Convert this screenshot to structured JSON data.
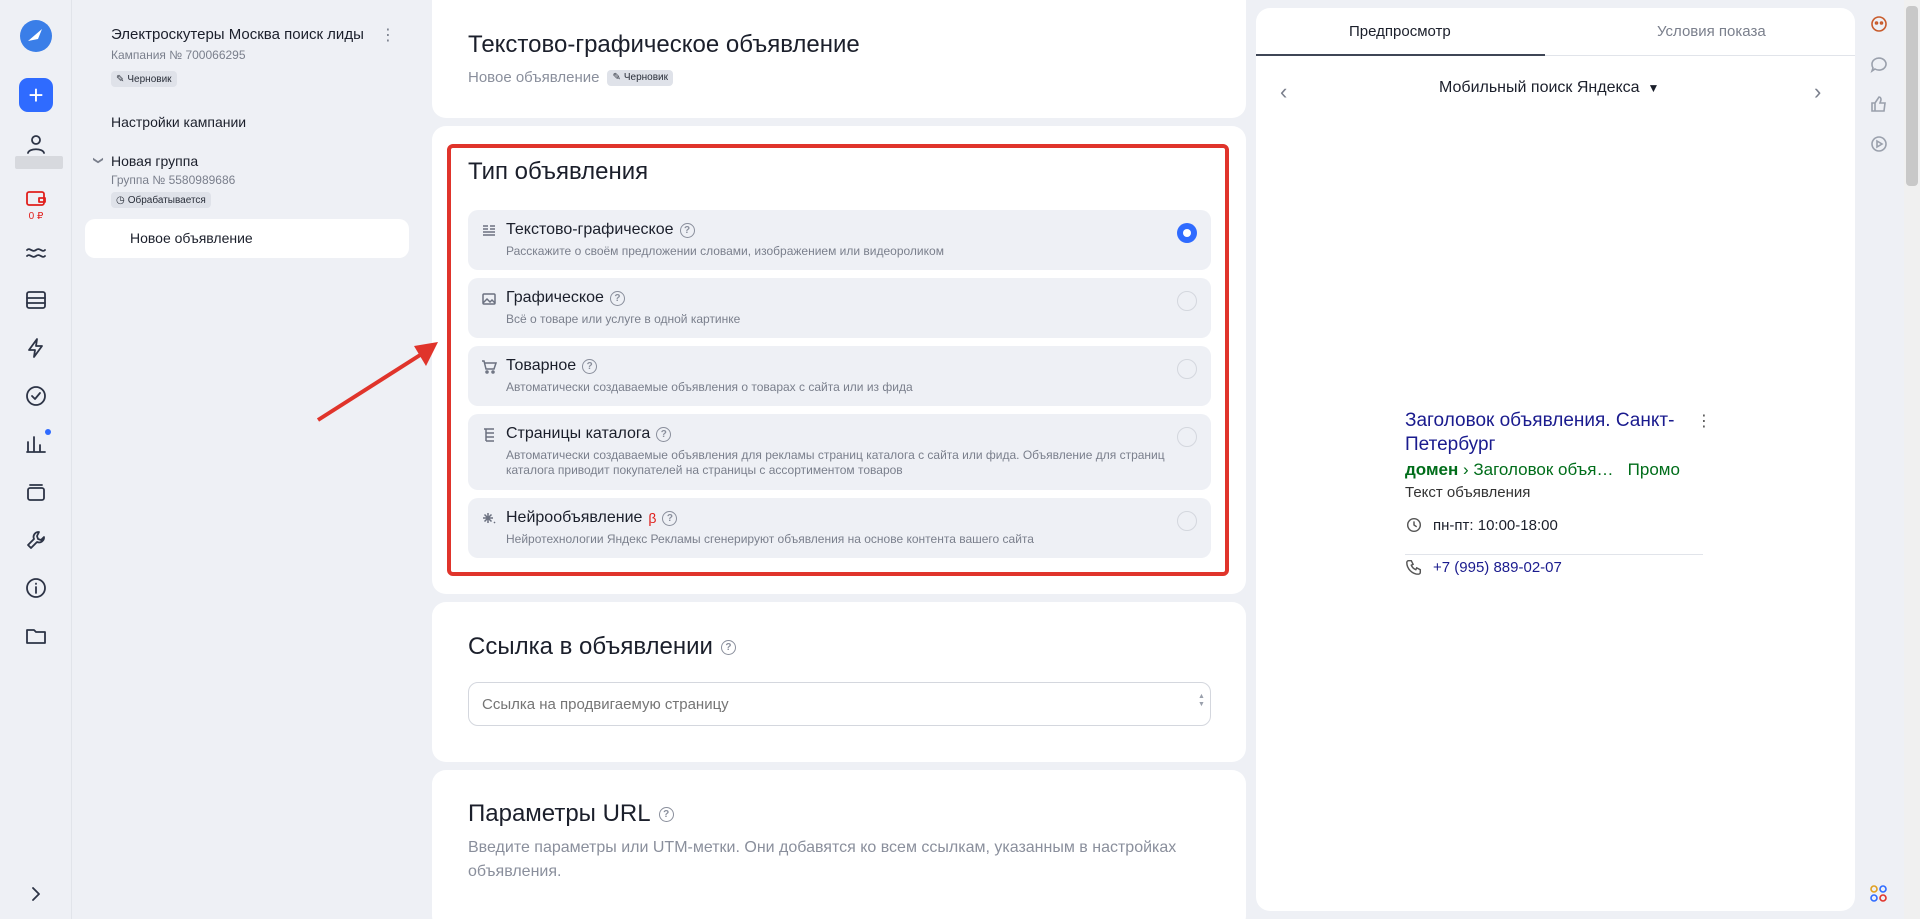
{
  "rail": {
    "wallet_amount": "0 ₽"
  },
  "sidebar": {
    "campaign_title": "Электроскутеры Москва поиск лиды",
    "campaign_number": "Кампания № 700066295",
    "campaign_status": "Черновик",
    "campaign_settings": "Настройки кампании",
    "group_title": "Новая группа",
    "group_number": "Группа № 5580989686",
    "group_status": "Обрабатывается",
    "ad_item": "Новое объявление"
  },
  "header": {
    "title": "Текстово-графическое объявление",
    "subtitle": "Новое объявление",
    "status": "Черновик"
  },
  "ad_type": {
    "title": "Тип объявления",
    "options": [
      {
        "label": "Текстово-графическое",
        "desc": "Расскажите о своём предложении словами, изображением или видеороликом",
        "selected": true,
        "icon": "text-lines-icon"
      },
      {
        "label": "Графическое",
        "desc": "Всё о товаре или услуге в одной картинке",
        "selected": false,
        "icon": "image-icon"
      },
      {
        "label": "Товарное",
        "desc": "Автоматически создаваемые объявления о товарах с сайта или из фида",
        "selected": false,
        "icon": "cart-icon"
      },
      {
        "label": "Страницы каталога",
        "desc": "Автоматически создаваемые объявления для рекламы страниц каталога с сайта или фида. Объявление для страниц каталога приводит покупателей на страницы с ассортиментом товаров",
        "selected": false,
        "icon": "catalog-tree-icon"
      },
      {
        "label": "Нейрообъявление",
        "beta": "β",
        "desc": "Нейротехнологии Яндекс Рекламы сгенерируют объявления на основе контента вашего сайта",
        "selected": false,
        "icon": "sparkle-icon"
      }
    ]
  },
  "link_section": {
    "title": "Ссылка в объявлении",
    "placeholder": "Ссылка на продвигаемую страницу"
  },
  "url_params": {
    "title": "Параметры URL",
    "desc": "Введите параметры или UTM-метки. Они добавятся ко всем ссылкам, указанным в настройках объявления."
  },
  "preview": {
    "tab_preview": "Предпросмотр",
    "tab_conditions": "Условия показа",
    "selector": "Мобильный поиск Яндекса",
    "ad_title": "Заголовок объявления. Санкт-Петербург",
    "ad_domain": "домен",
    "ad_path": "› Заголовок объя…",
    "ad_promo": "Промо",
    "ad_text": "Текст объявления",
    "hours": "пн-пт: 10:00-18:00",
    "phone": "+7 (995) 889-02-07"
  },
  "colors": {
    "accent": "#2f6bff",
    "highlight": "#e0342b",
    "link": "#1a1b8e",
    "domain": "#006d1a"
  }
}
